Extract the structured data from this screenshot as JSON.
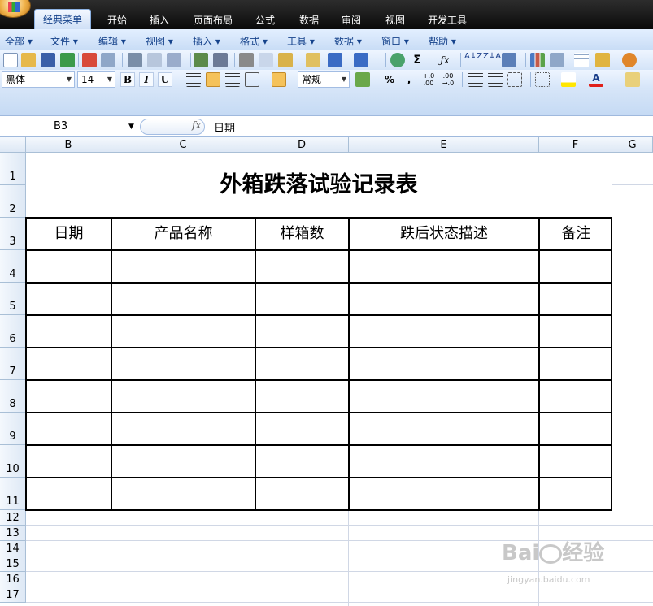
{
  "ribbon_tabs": [
    "经典菜单",
    "开始",
    "插入",
    "页面布局",
    "公式",
    "数据",
    "审阅",
    "视图",
    "开发工具"
  ],
  "menus": [
    "全部",
    "文件",
    "编辑",
    "视图",
    "插入",
    "格式",
    "工具",
    "数据",
    "窗口",
    "帮助"
  ],
  "font": {
    "name": "黑体",
    "size": "14"
  },
  "format_combo": "常规",
  "formula_bar": {
    "name_box": "B3",
    "fx": "fx",
    "value": "日期"
  },
  "columns": [
    "B",
    "C",
    "D",
    "E",
    "F",
    "G"
  ],
  "rows": [
    "1",
    "2",
    "3",
    "4",
    "5",
    "6",
    "7",
    "8",
    "9",
    "10",
    "11",
    "12",
    "13",
    "14",
    "15",
    "16",
    "17"
  ],
  "sheet": {
    "title": "外箱跌落试验记录表",
    "headers": [
      "日期",
      "产品名称",
      "样箱数",
      "跌后状态描述",
      "备注"
    ]
  },
  "watermark": {
    "text": "Baidu经验",
    "url": "jingyan.baidu.com"
  }
}
